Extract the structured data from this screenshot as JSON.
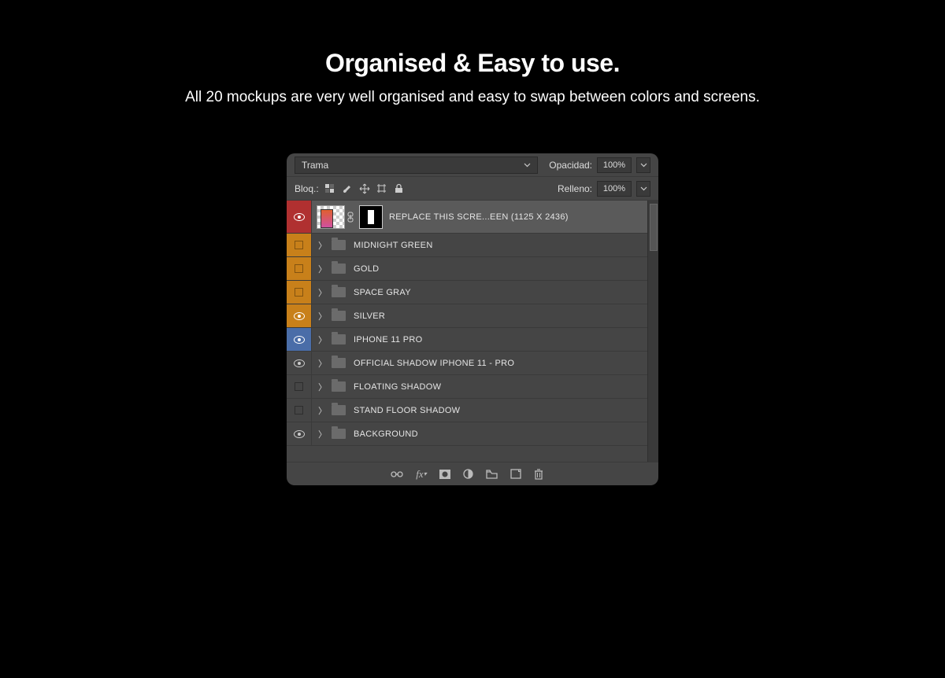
{
  "hero": {
    "title": "Organised & Easy to use.",
    "subtitle": "All 20 mockups are very well organised and easy to swap between colors and screens."
  },
  "panel": {
    "blend_mode": "Trama",
    "opacity_label": "Opacidad:",
    "opacity_value": "100%",
    "lock_label": "Bloq.:",
    "fill_label": "Relleno:",
    "fill_value": "100%",
    "selected_layer_name": "REPLACE THIS SCRE...EEN (1125 X 2436)",
    "layers": [
      {
        "name": "MIDNIGHT GREEN",
        "visible": false,
        "color": "orange"
      },
      {
        "name": "GOLD",
        "visible": false,
        "color": "orange"
      },
      {
        "name": "SPACE GRAY",
        "visible": false,
        "color": "orange"
      },
      {
        "name": "SILVER",
        "visible": true,
        "color": "orange"
      },
      {
        "name": "IPHONE 11 PRO",
        "visible": true,
        "color": "blue"
      },
      {
        "name": "OFFICIAL SHADOW IPHONE 11 - PRO",
        "visible": true,
        "color": "gray"
      },
      {
        "name": "FLOATING SHADOW",
        "visible": false,
        "color": "gray"
      },
      {
        "name": "STAND FLOOR SHADOW",
        "visible": false,
        "color": "gray"
      },
      {
        "name": "BACKGROUND",
        "visible": true,
        "color": "gray"
      }
    ]
  }
}
